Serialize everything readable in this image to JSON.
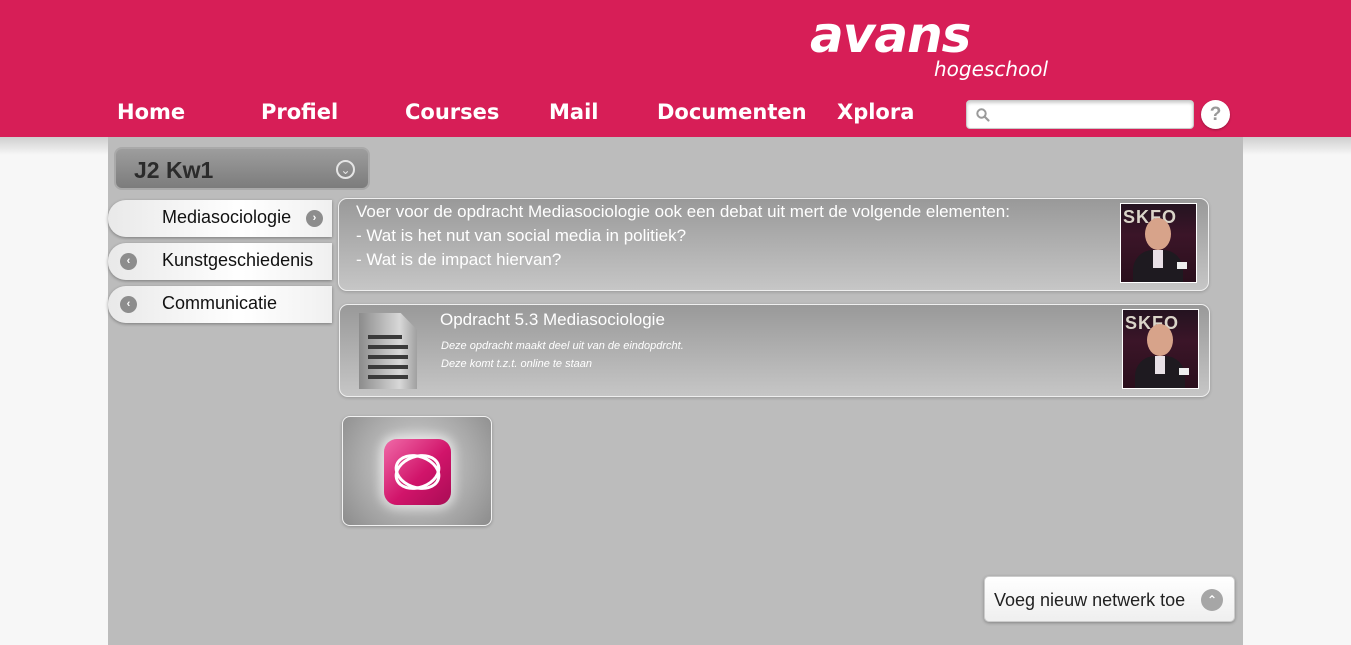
{
  "brand": {
    "name": "avans",
    "subtitle": "hogeschool",
    "color": "#d71e57"
  },
  "nav": [
    {
      "label": "Home"
    },
    {
      "label": "Profiel"
    },
    {
      "label": "Courses"
    },
    {
      "label": "Mail"
    },
    {
      "label": "Documenten"
    },
    {
      "label": "Xplora"
    }
  ],
  "search": {
    "value": "",
    "placeholder": "",
    "icon": "search-icon"
  },
  "help": {
    "label": "?",
    "icon": "help-icon"
  },
  "term": {
    "label": "J2 Kw1",
    "icon": "chevron-down-icon"
  },
  "courses": [
    {
      "label": "Mediasociologie",
      "icon": "chevron-right-icon",
      "active": true
    },
    {
      "label": "Kunstgeschiedenis",
      "icon": "chevron-left-icon",
      "active": false
    },
    {
      "label": "Communicatie",
      "icon": "chevron-left-icon",
      "active": false
    }
  ],
  "posts": [
    {
      "lines": [
        "Voer voor de opdracht Mediasociologie ook een debat uit mert de volgende elementen:",
        "- Wat is het nut van social media in politiek?",
        "- Wat is de impact hiervan?"
      ],
      "avatar_text": "SKFO"
    },
    {
      "title": "Opdracht 5.3 Mediasociologie",
      "desc": [
        "Deze opdracht maakt deel uit van de eindopdrcht.",
        "Deze komt t.z.t. online te staan"
      ],
      "icon": "document-icon",
      "avatar_text": "SKFO"
    }
  ],
  "app": {
    "icon": "xplora-app-icon"
  },
  "add_network": {
    "label": "Voeg nieuw netwerk toe",
    "icon": "chevron-up-icon"
  }
}
